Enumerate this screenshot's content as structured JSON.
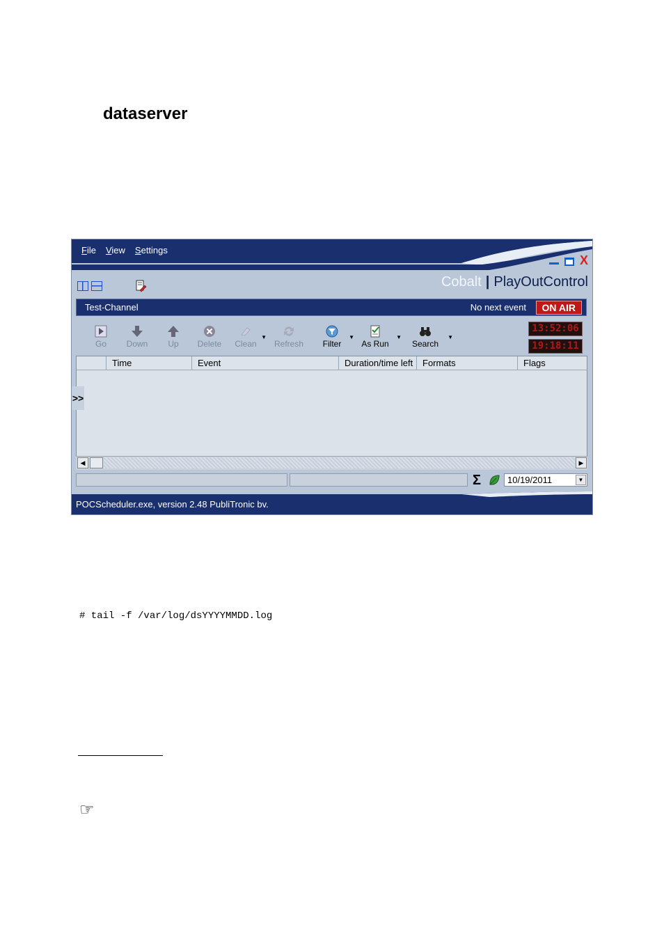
{
  "heading": "dataserver",
  "window": {
    "menu": [
      {
        "label": "File",
        "mnemonic": "F",
        "rest": "ile"
      },
      {
        "label": "View",
        "mnemonic": "V",
        "rest": "iew"
      },
      {
        "label": "Settings",
        "mnemonic": "S",
        "rest": "ettings"
      }
    ],
    "brand": {
      "part1": "Cobalt",
      "separator": "|",
      "part2": "PlayOutControl"
    },
    "channel": "Test-Channel",
    "next_event": "No next event",
    "on_air": "ON AIR",
    "toolbar": [
      {
        "label": "Go",
        "enabled": false
      },
      {
        "label": "Down",
        "enabled": false
      },
      {
        "label": "Up",
        "enabled": false
      },
      {
        "label": "Delete",
        "enabled": false
      },
      {
        "label": "Clean",
        "enabled": false
      },
      {
        "label": "Refresh",
        "enabled": false
      },
      {
        "label": "Filter",
        "enabled": true
      },
      {
        "label": "As Run",
        "enabled": true
      },
      {
        "label": "Search",
        "enabled": true
      }
    ],
    "clocks": [
      "13:52:06",
      "19:18:11"
    ],
    "columns": [
      "",
      "Time",
      "Event",
      "Duration/time left",
      "Formats",
      "Flags"
    ],
    "side_tab": ">>",
    "date": "10/19/2011",
    "sigma": "Σ",
    "footer": "POCScheduler.exe, version 2.48 PubliTronic bv."
  },
  "command": "# tail -f /var/log/dsYYYYMMDD.log",
  "hand_glyph": "☞",
  "colors": {
    "accent_navy": "#1a2f6e",
    "on_air_red": "#c01818",
    "clock_red": "#b01818"
  }
}
